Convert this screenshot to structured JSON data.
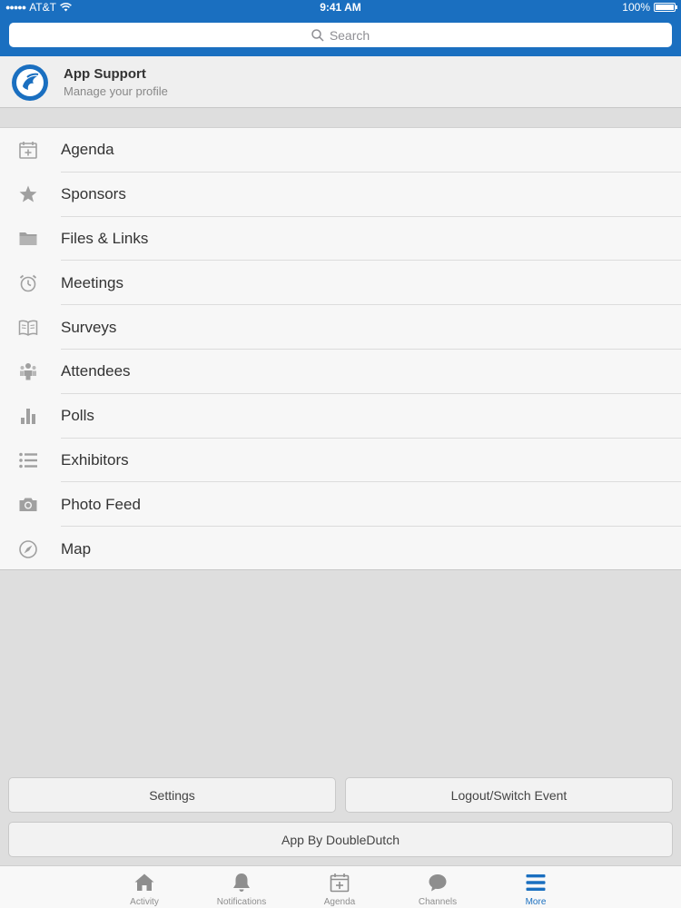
{
  "status_bar": {
    "carrier": "AT&T",
    "time": "9:41 AM",
    "battery": "100%"
  },
  "search": {
    "placeholder": "Search"
  },
  "profile": {
    "name": "App Support",
    "subtitle": "Manage your profile"
  },
  "menu": {
    "items": [
      {
        "label": "Agenda",
        "icon": "calendar-icon"
      },
      {
        "label": "Sponsors",
        "icon": "star-icon"
      },
      {
        "label": "Files & Links",
        "icon": "folder-icon"
      },
      {
        "label": "Meetings",
        "icon": "alarm-clock-icon"
      },
      {
        "label": "Surveys",
        "icon": "book-icon"
      },
      {
        "label": "Attendees",
        "icon": "people-icon"
      },
      {
        "label": "Polls",
        "icon": "bar-chart-icon"
      },
      {
        "label": "Exhibitors",
        "icon": "list-icon"
      },
      {
        "label": "Photo Feed",
        "icon": "camera-icon"
      },
      {
        "label": "Map",
        "icon": "compass-icon"
      }
    ]
  },
  "buttons": {
    "settings": "Settings",
    "logout": "Logout/Switch Event",
    "app_by": "App By DoubleDutch"
  },
  "tabbar": {
    "tabs": [
      {
        "label": "Activity",
        "icon": "home-icon"
      },
      {
        "label": "Notifications",
        "icon": "bell-icon"
      },
      {
        "label": "Agenda",
        "icon": "calendar-icon"
      },
      {
        "label": "Channels",
        "icon": "chat-bubble-icon"
      },
      {
        "label": "More",
        "icon": "menu-icon"
      }
    ],
    "active": "More"
  },
  "colors": {
    "accent": "#1a6fc0",
    "icon_gray": "#a0a0a0"
  }
}
